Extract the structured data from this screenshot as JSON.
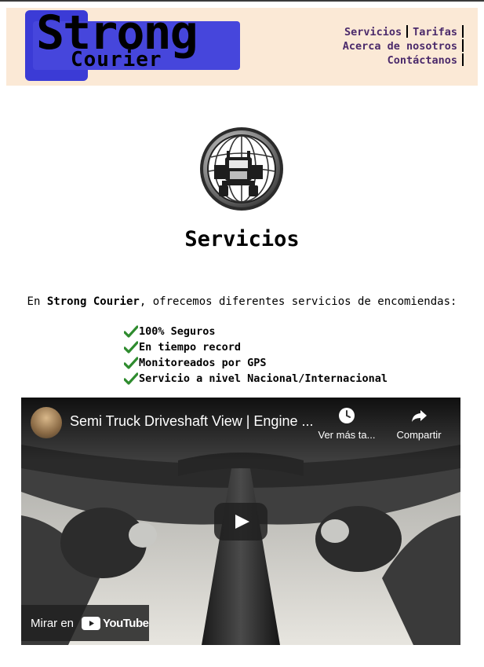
{
  "logo": {
    "line1": "Strong",
    "line2": "Courier"
  },
  "nav": {
    "items": [
      "Servicios",
      "Tarifas",
      "Acerca de nosotros",
      "Contáctanos"
    ]
  },
  "page": {
    "title": "Servicios",
    "intro_prefix": "En ",
    "intro_brand": "Strong Courier",
    "intro_suffix": ", ofrecemos diferentes servicios de encomiendas:"
  },
  "features": [
    "100% Seguros",
    "En tiempo record",
    "Monitoreados por GPS",
    "Servicio a nivel Nacional/Internacional"
  ],
  "video": {
    "title": "Semi Truck Driveshaft View | Engine ...",
    "watch_later": "Ver más ta...",
    "share": "Compartir",
    "watch_on": "Mirar en",
    "platform": "YouTube"
  },
  "colors": {
    "header_bg": "#fbe9d6",
    "logo_blue": "#4646dc",
    "nav_text": "#4b2a6b",
    "check_green": "#2e8b2e"
  },
  "icons": [
    "globe-truck-emblem",
    "check-icon",
    "clock-icon",
    "share-icon",
    "play-icon",
    "youtube-icon"
  ]
}
